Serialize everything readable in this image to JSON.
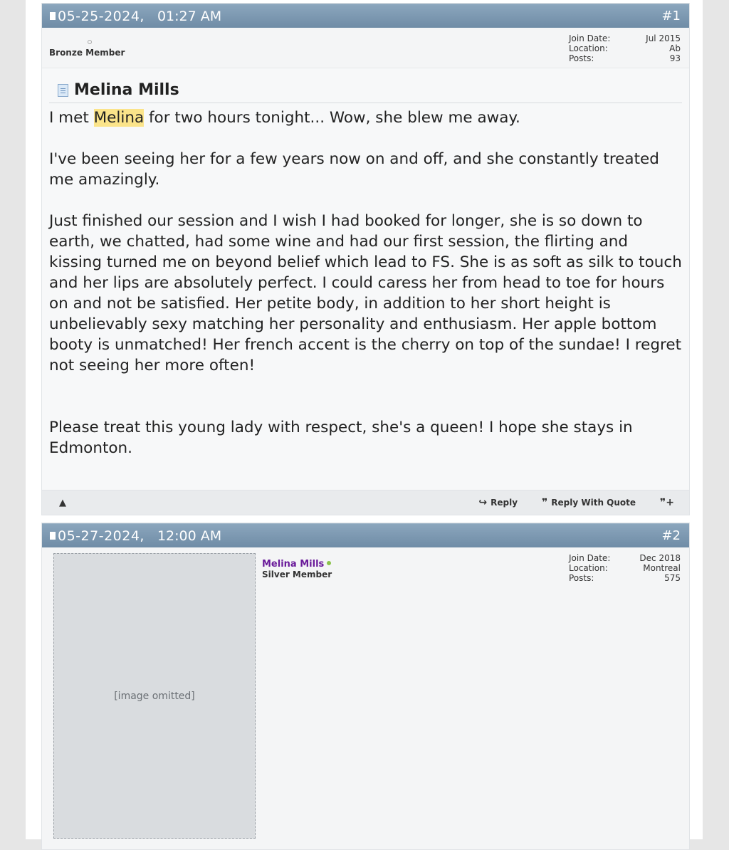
{
  "post1": {
    "date": "05-25-2024,",
    "time": "01:27 AM",
    "number": "#1",
    "member_title": "Bronze Member",
    "stats": {
      "join_label": "Join Date:",
      "join_value": "Jul 2015",
      "location_label": "Location:",
      "location_value": "Ab",
      "posts_label": "Posts:",
      "posts_value": "93"
    },
    "title": "Melina Mills",
    "p1_before": "I met ",
    "p1_highlight": "Melina",
    "p1_after": " for two hours tonight... Wow, she blew me away.",
    "p2": "I've been seeing her for a few years now on and off, and she constantly treated me amazingly.",
    "p3": "Just finished our session and I wish I had booked for longer, she is so down to earth, we chatted, had some wine and had our first session, the flirting and kissing turned me on beyond belief which lead to FS. She is as soft as silk to touch and her lips are absolutely perfect. I could caress her from head to toe for hours on and not be satisfied. Her petite body, in addition to her short height is unbelievably sexy matching her personality and enthusiasm. Her apple bottom booty is unmatched! Her french accent is the cherry on top of the sundae! I regret not seeing her more often!",
    "p4": "Please treat this young lady with respect, she's a queen! I hope she stays in Edmonton.",
    "reply_label": "Reply",
    "reply_quote_label": "Reply With Quote"
  },
  "post2": {
    "date": "05-27-2024,",
    "time": "12:00 AM",
    "number": "#2",
    "username": "Melina Mills",
    "member_title": "Silver Member",
    "stats": {
      "join_label": "Join Date:",
      "join_value": "Dec 2018",
      "location_label": "Location:",
      "location_value": "Montreal",
      "posts_label": "Posts:",
      "posts_value": "575"
    },
    "photo_note": "[image omitted]"
  },
  "colors": {
    "header": "#7893ab",
    "username": "#6a1b9a",
    "highlight": "#fbe48a"
  }
}
